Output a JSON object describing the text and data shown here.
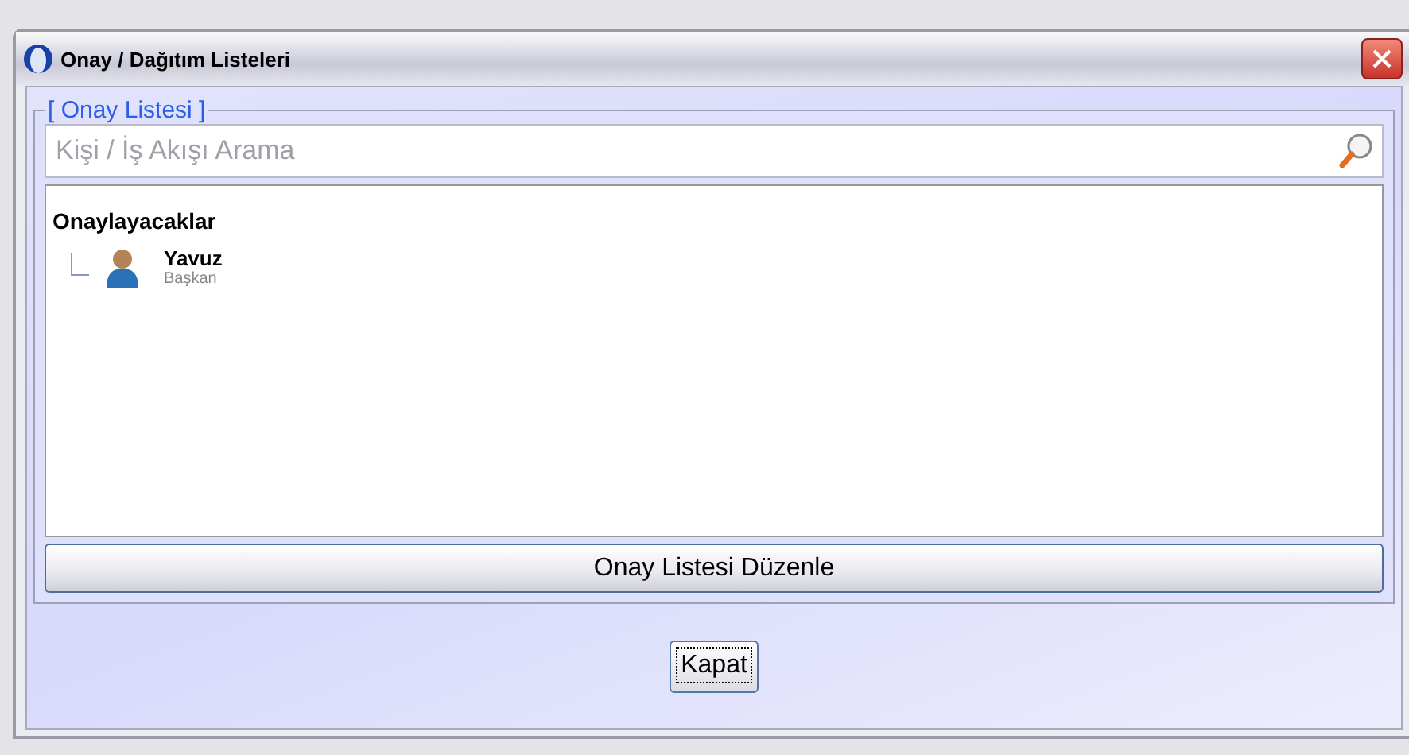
{
  "window": {
    "title": "Onay / Dağıtım Listeleri"
  },
  "panel": {
    "legend": "[ Onay Listesi ]",
    "search": {
      "placeholder": "Kişi / İş Akışı Arama"
    },
    "tree": [
      {
        "label": "Onaylayacaklar",
        "children": [
          {
            "name": "Yavuz",
            "role": "Başkan"
          }
        ]
      }
    ],
    "edit_button": "Onay Listesi Düzenle"
  },
  "buttons": [
    "Kapat"
  ]
}
